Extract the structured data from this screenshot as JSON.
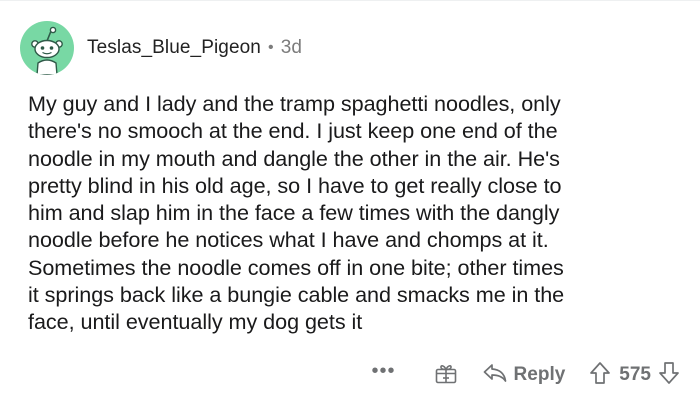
{
  "comment": {
    "author": "Teslas_Blue_Pigeon",
    "separator": "•",
    "age": "3d",
    "avatar_icon": "snoo-avatar-icon",
    "avatar_color": "#78d8a4",
    "body": "My guy and I lady and the tramp spaghetti noodles, only\nthere's no smooch at the end.  I just keep one end of the\nnoodle in my mouth and dangle the other in the air.  He's\npretty blind in his old age, so I have to get really close to\nhim and slap him in the face a few times with the dangly\nnoodle before he notices what I have and chomps at it.\nSometimes the noodle comes off in one bite; other times\nit springs back like a bungie cable and smacks me in the\nface, until eventually my dog gets it"
  },
  "actions": {
    "more_label": "•••",
    "award_icon": "gift-award-icon",
    "reply_icon": "reply-arrow-icon",
    "reply_label": "Reply",
    "upvote_icon": "upvote-arrow-icon",
    "score": "575",
    "downvote_icon": "downvote-arrow-icon",
    "icon_color": "#6f7173"
  }
}
